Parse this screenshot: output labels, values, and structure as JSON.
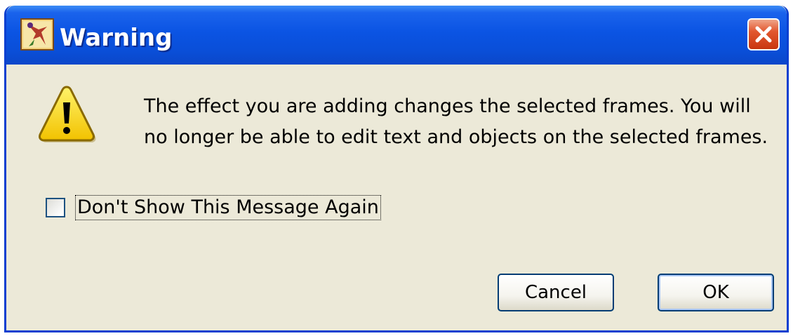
{
  "dialog": {
    "title": "Warning",
    "icons": {
      "app": "application-icon",
      "close": "close-icon",
      "warning": "warning-icon"
    },
    "message": "The effect you are adding changes the selected frames.  You will no longer be able to edit text and objects on the selected frames.",
    "checkbox": {
      "label": "Don't Show This Message Again",
      "checked": false
    },
    "buttons": {
      "cancel": "Cancel",
      "ok": "OK"
    }
  },
  "colors": {
    "titlebar": "#0b54e3",
    "close": "#e2572f",
    "body": "#ece9d8"
  }
}
